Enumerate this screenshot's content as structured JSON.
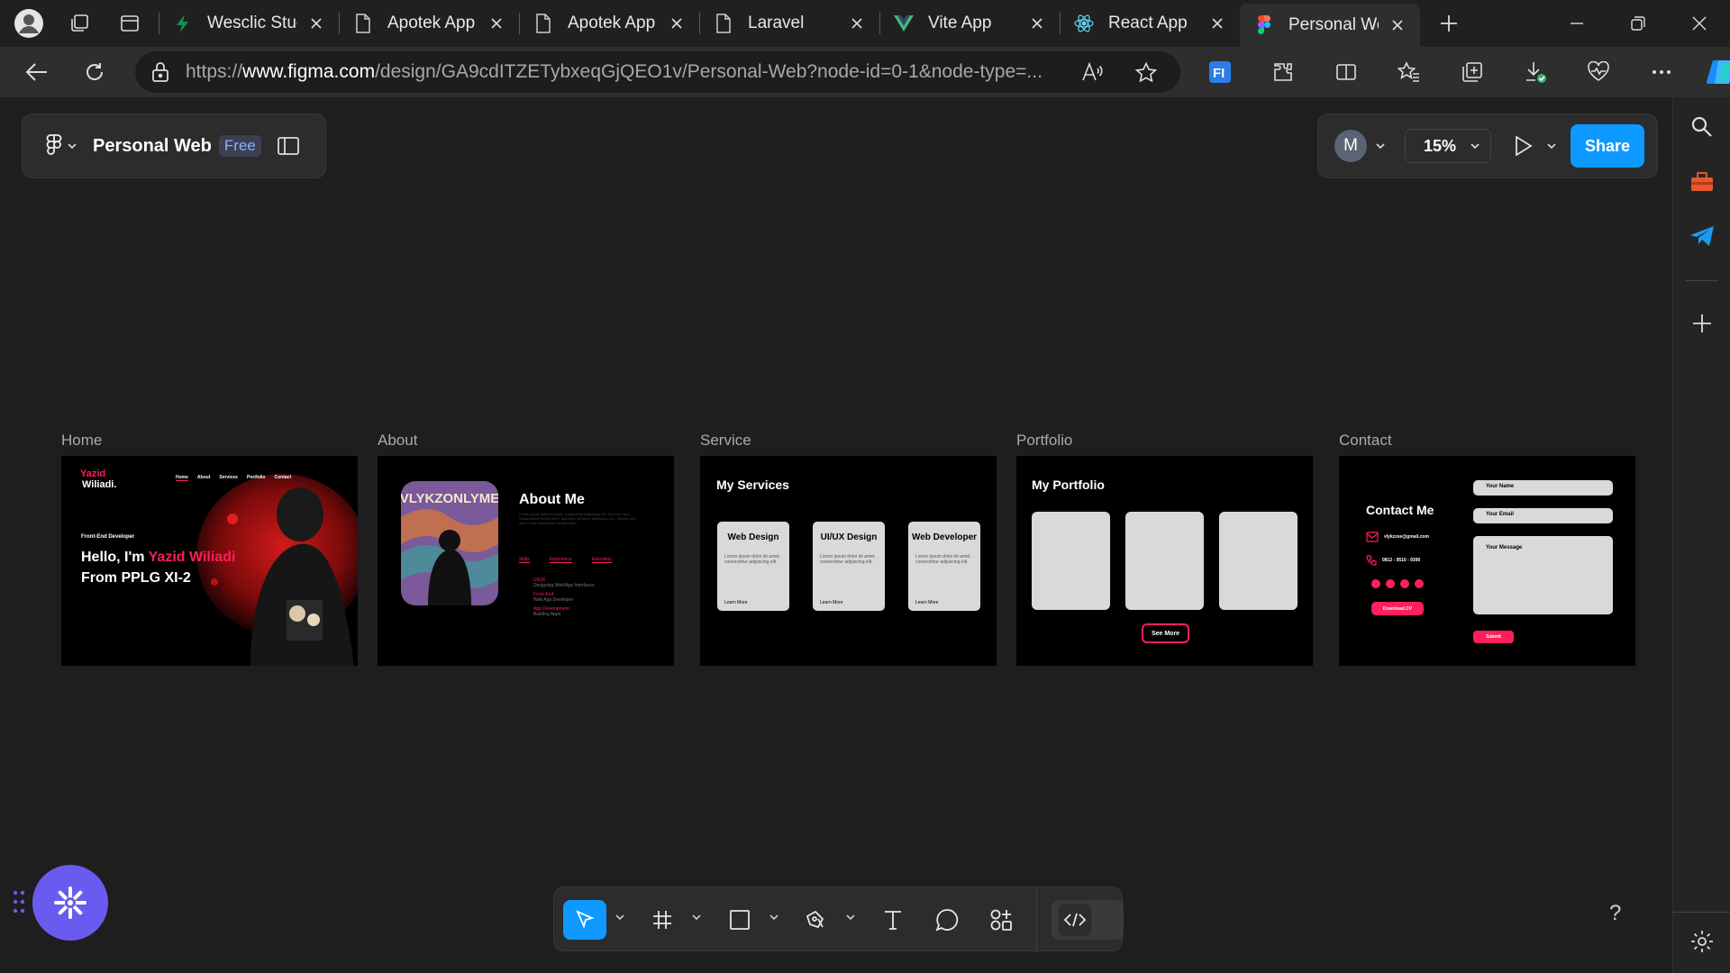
{
  "tabs": [
    {
      "title": "Wesclic Studio",
      "icon": "bolt-icon",
      "active": false
    },
    {
      "title": "Apotek App",
      "icon": "page-icon",
      "active": false
    },
    {
      "title": "Apotek App",
      "icon": "page-icon",
      "active": false
    },
    {
      "title": "Laravel",
      "icon": "page-icon",
      "active": false
    },
    {
      "title": "Vite App",
      "icon": "vue-icon",
      "active": false
    },
    {
      "title": "React App",
      "icon": "react-icon",
      "active": false
    },
    {
      "title": "Personal Web",
      "icon": "figma-icon",
      "active": true
    }
  ],
  "address": {
    "prefix": "https://",
    "domain": "www.figma.com",
    "path": "/design/GA9cdITZETybxeqGjQEO1v/Personal-Web?node-id=0-1&node-type=..."
  },
  "file": {
    "name": "Personal Web",
    "plan": "Free"
  },
  "user": {
    "initial": "M"
  },
  "zoom": "15%",
  "share_label": "Share",
  "frames": {
    "home": {
      "label": "Home",
      "logo_first": "Yazid",
      "logo_last": "Wiliadi.",
      "nav": [
        "Home",
        "About",
        "Services",
        "Portfolio",
        "Contact"
      ],
      "role": "Front-End Developer",
      "hello": "Hello, I'm ",
      "name": "Yazid Wiliadi",
      "from": "From PPLG XI-2"
    },
    "about": {
      "label": "About",
      "title": "About Me",
      "poster": "VLYKZONLYME",
      "desc": "Lorem ipsum dolor sit amet, consectetur adipiscing elit. Sed non risus. Suspendisse lectus tortor, dignissim sit amet, adipiscing nec, ultricies sed, dolor. Cras elementum ultrices diam.",
      "tabs": [
        "Skills",
        "Experience",
        "Education"
      ],
      "skills": [
        {
          "title": "UI/UX",
          "desc": "Designing Web/App Interfaces"
        },
        {
          "title": "Front-End",
          "desc": "Web App Developer"
        },
        {
          "title": "App Development",
          "desc": "Building Apps"
        }
      ]
    },
    "service": {
      "label": "Service",
      "title": "My Services",
      "cards": [
        {
          "title": "Web Design",
          "desc": "Lorem ipsum dolor sit amet, consectetur adipiscing elit.",
          "link": "Learn More"
        },
        {
          "title": "UI/UX Design",
          "desc": "Lorem ipsum dolor sit amet, consectetur adipiscing elit.",
          "link": "Learn More"
        },
        {
          "title": "Web Developer",
          "desc": "Lorem ipsum dolor sit amet, consectetur adipiscing elit.",
          "link": "Learn More"
        }
      ]
    },
    "portfolio": {
      "label": "Portfolio",
      "title": "My Portfolio",
      "button": "See More"
    },
    "contact": {
      "label": "Contact",
      "title": "Contact Me",
      "email": "vlykzzee@gmail.com",
      "phone": "0812 - 9510 - 9390",
      "cv": "Download CV",
      "name_field": "Your Name",
      "email_field": "Your Email",
      "message_field": "Your Message",
      "submit": "Submit"
    }
  },
  "colors": {
    "accent": "#ff1f5a",
    "share": "#0d99ff",
    "fab": "#6a5bf0"
  },
  "help": "?"
}
